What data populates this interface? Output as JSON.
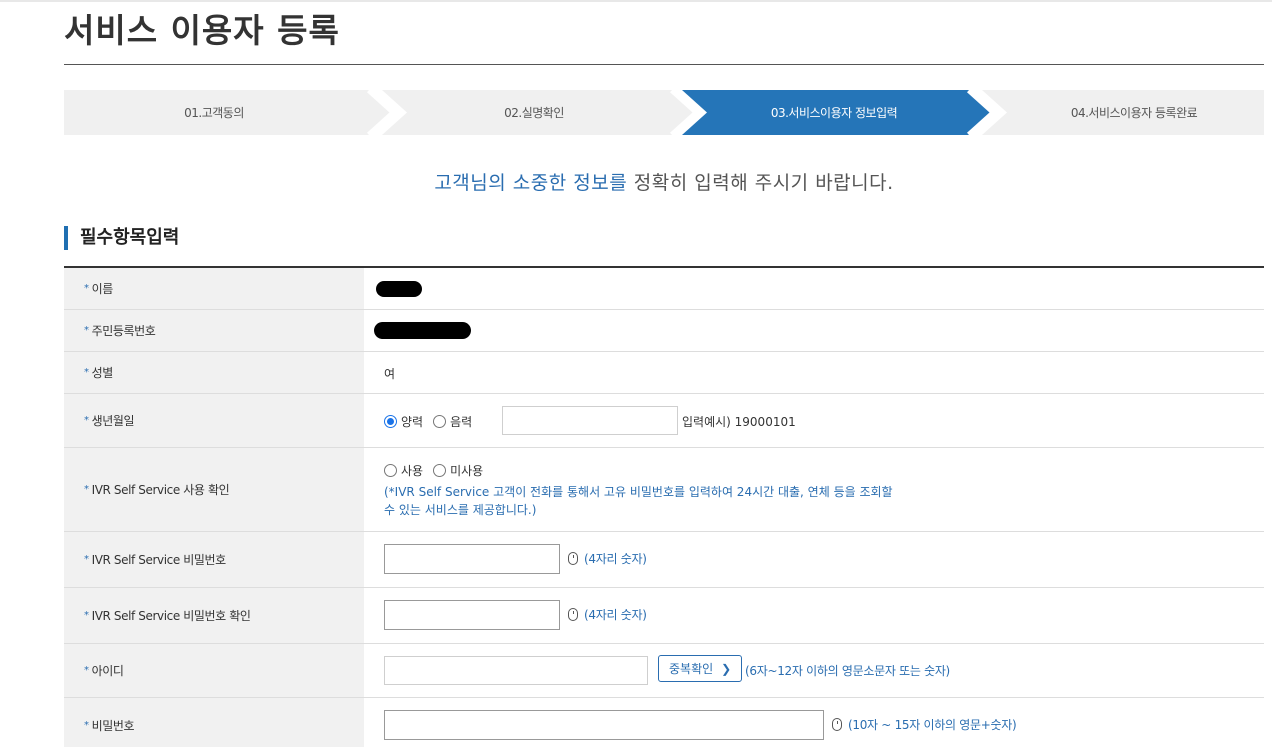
{
  "page": {
    "title": "서비스 이용자 등록"
  },
  "steps": [
    {
      "label": "01.고객동의",
      "active": false
    },
    {
      "label": "02.실명확인",
      "active": false
    },
    {
      "label": "03.서비스이용자 정보입력",
      "active": true
    },
    {
      "label": "04.서비스이용자 등록완료",
      "active": false
    }
  ],
  "intro": {
    "accent": "고객님의 소중한 정보를",
    "rest": " 정확히 입력해 주시기 바랍니다."
  },
  "section": {
    "title": "필수항목입력"
  },
  "form": {
    "required_mark": "*",
    "name_label": "이름",
    "rrn_label": "주민등록번호",
    "gender_label": "성별",
    "gender_value": "여",
    "birth_label": "생년월일",
    "birth_solar": "양력",
    "birth_lunar": "음력",
    "birth_hint": "입력예시) 19000101",
    "ivr_use_label": "IVR Self Service 사용 확인",
    "ivr_use_yes": "사용",
    "ivr_use_no": "미사용",
    "ivr_note_line1": "(*IVR Self Service 고객이 전화를 통해서 고유 비밀번호를 입력하여 24시간 대출, 연체 등을 조회할",
    "ivr_note_line2": "수 있는 서비스를 제공합니다.)",
    "ivr_pw_label": "IVR Self Service 비밀번호",
    "ivr_pw_hint": "(4자리 숫자)",
    "ivr_pw_confirm_label": "IVR Self Service 비밀번호 확인",
    "ivr_pw_confirm_hint": "(4자리 숫자)",
    "id_label": "아이디",
    "id_check_button": "중복확인",
    "id_hint": "(6자~12자 이하의 영문소문자 또는 숫자)",
    "pw_label": "비밀번호",
    "pw_hint": "(10자 ~ 15자 이하의 영문+숫자)"
  },
  "colors": {
    "accent": "#2a6db0",
    "step_active": "#2575b8",
    "step_inactive": "#f0f0f0"
  }
}
